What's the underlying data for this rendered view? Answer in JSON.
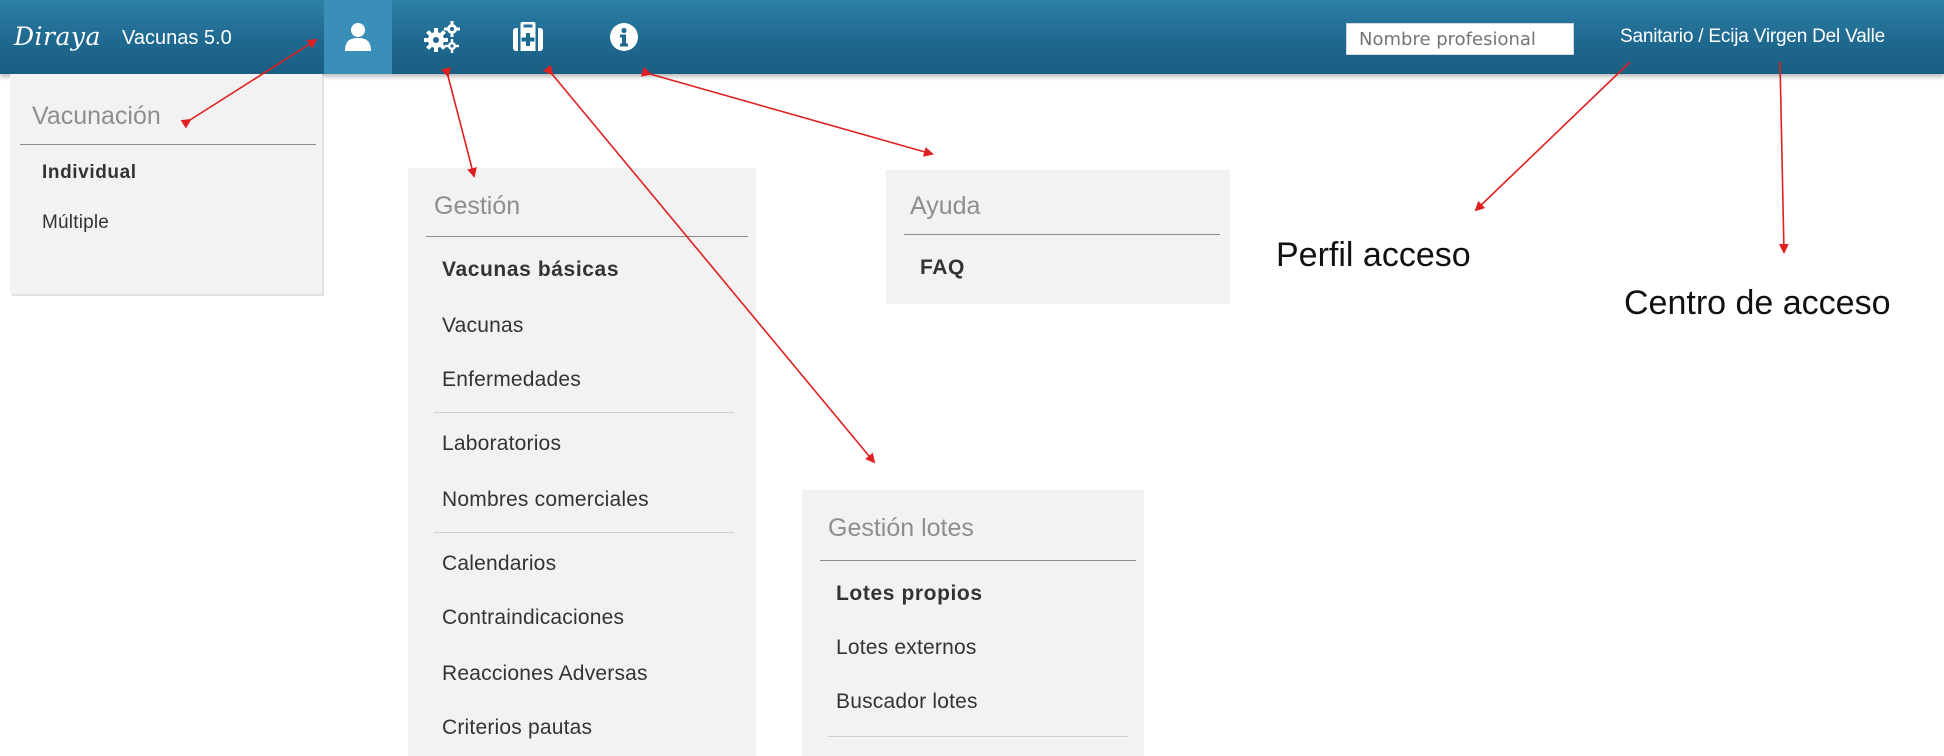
{
  "header": {
    "brand": "Diraya",
    "version": "Vacunas 5.0",
    "nav_icons": [
      "user-icon",
      "gears-icon",
      "medical-kit-icon",
      "info-icon"
    ],
    "search": {
      "placeholder": "Nombre profesional",
      "value": "Nombre profesional"
    },
    "user_info": "Sanitario / Ecija Virgen Del Valle",
    "colors": {
      "bar": "#1f6990",
      "active_tab": "#3a8fb8"
    }
  },
  "menus": {
    "vacunacion": {
      "title": "Vacunación",
      "items": [
        "Individual",
        "Múltiple"
      ]
    },
    "gestion": {
      "title": "Gestión",
      "items": [
        "Vacunas básicas",
        "Vacunas",
        "Enfermedades",
        "Laboratorios",
        "Nombres comerciales",
        "Calendarios",
        "Contraindicaciones",
        "Reacciones Adversas",
        "Criterios pautas"
      ]
    },
    "ayuda": {
      "title": "Ayuda",
      "items": [
        "FAQ"
      ]
    },
    "lotes": {
      "title": "Gestión lotes",
      "items": [
        "Lotes propios",
        "Lotes externos",
        "Buscador lotes"
      ]
    }
  },
  "annotations": {
    "perfil": "Perfil acceso",
    "centro": "Centro de acceso"
  },
  "arrow_color": "#e02020"
}
